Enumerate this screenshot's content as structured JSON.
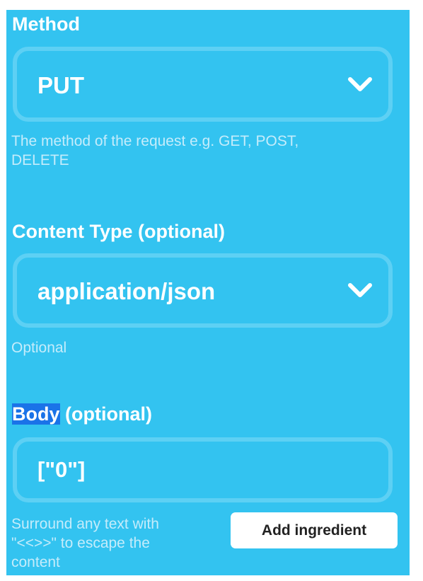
{
  "method": {
    "label": "Method",
    "value": "PUT",
    "help_line1": "The method of the request e.g. GET, POST,",
    "help_line2": "DELETE",
    "dropdown_icon": "chevron-down-icon"
  },
  "content_type": {
    "label": "Content Type (optional)",
    "value": "application/json",
    "help": "Optional",
    "dropdown_icon": "chevron-down-icon"
  },
  "body": {
    "label_highlighted": "Body",
    "label_rest": " (optional)",
    "value": "[\"0\"]",
    "help_line1": "Surround any text with",
    "help_line2": "\"<<>>\" to escape the",
    "help_line3": "content",
    "add_ingredient_label": "Add ingredient"
  },
  "colors": {
    "panel_background": "#33c3f0",
    "field_border": "#5dd0f4",
    "help_text": "#c4ecfb",
    "selection_highlight": "#1a73e8",
    "button_background": "#ffffff"
  }
}
